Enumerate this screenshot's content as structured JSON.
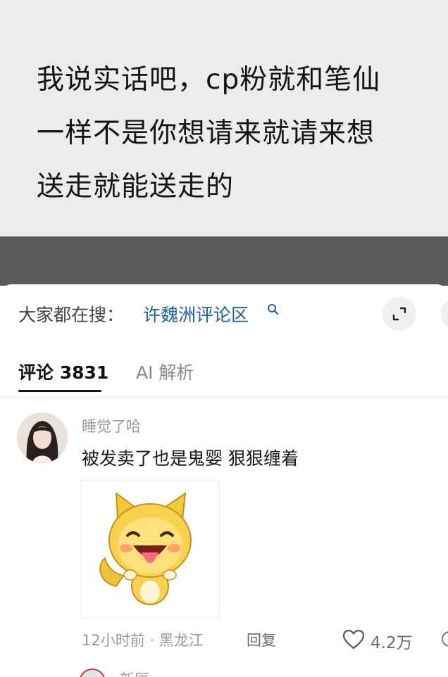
{
  "quote": {
    "text": "我说实话吧，cp粉就和笔仙\n一样不是你想请来就请来想\n送走就能送走的"
  },
  "search_bar": {
    "prefix": "大家都在搜：",
    "term": "许魏洲评论区",
    "icon": "search-icon"
  },
  "tabs": [
    {
      "label": "评论 3831",
      "active": true
    },
    {
      "label": "AI 解析",
      "active": false
    }
  ],
  "comment": {
    "username": "睡觉了哈",
    "text": "被发卖了也是鬼婴 狠狠缠着",
    "sticker": "fox-emoji-sticker",
    "time_location": "12小时前 · 黑龙江",
    "reply_label": "回复",
    "likes": "4.2万"
  },
  "next_comment": {
    "username": "新匣"
  },
  "colors": {
    "link_blue": "#1c5fa6",
    "quote_bg": "#ececec",
    "dark_band": "#5b5b5b"
  }
}
